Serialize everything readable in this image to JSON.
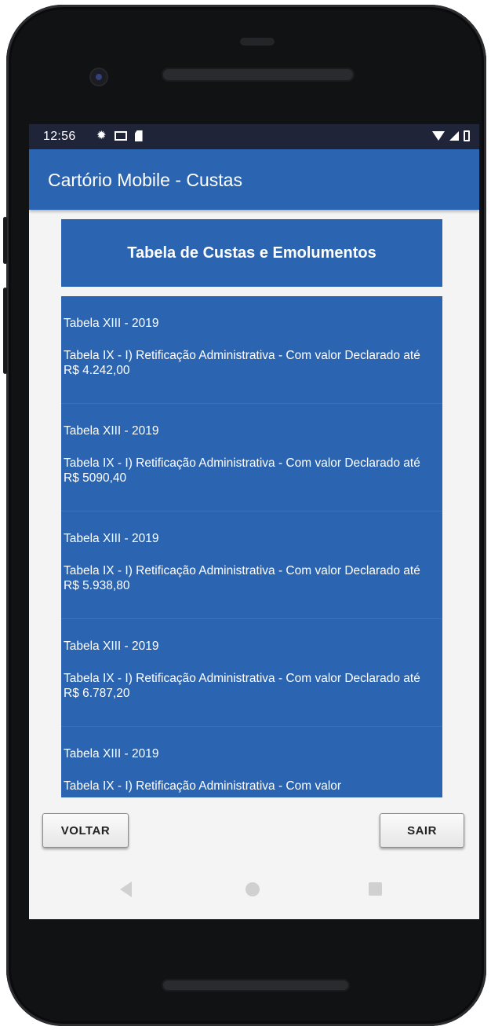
{
  "status_bar": {
    "time": "12:56",
    "left_icons": [
      "gear-icon",
      "mail-icon",
      "sd-card-icon"
    ],
    "right_icons": [
      "wifi-icon",
      "signal-icon",
      "battery-icon"
    ]
  },
  "app_bar": {
    "title": "Cartório Mobile - Custas",
    "color": "#2b64b0"
  },
  "header": {
    "title": "Tabela de Custas e Emolumentos"
  },
  "list": {
    "items": [
      {
        "line1": "Tabela XIII - 2019",
        "line2": "Tabela IX - I) Retificação Administrativa - Com valor Declarado até R$ 4.242,00"
      },
      {
        "line1": "Tabela XIII - 2019",
        "line2": "Tabela IX - I) Retificação Administrativa - Com valor Declarado até R$ 5090,40"
      },
      {
        "line1": "Tabela XIII - 2019",
        "line2": "Tabela IX - I) Retificação Administrativa - Com valor Declarado até R$ 5.938,80"
      },
      {
        "line1": "Tabela XIII - 2019",
        "line2": "Tabela IX - I) Retificação Administrativa - Com valor Declarado até R$ 6.787,20"
      },
      {
        "line1": "Tabela XIII - 2019",
        "line2": "Tabela IX - I) Retificação Administrativa - Com valor"
      }
    ]
  },
  "buttons": {
    "back_label": "VOLTAR",
    "exit_label": "SAIR"
  },
  "nav_bar": {
    "icons": [
      "back-icon",
      "home-icon",
      "recent-apps-icon"
    ]
  }
}
